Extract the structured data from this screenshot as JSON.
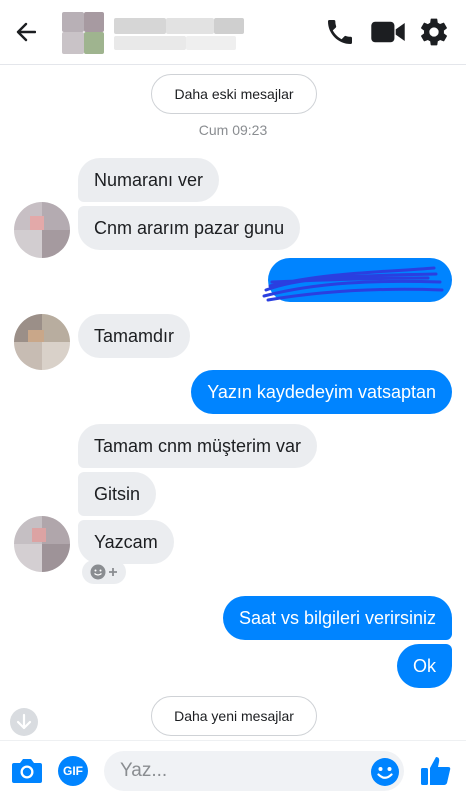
{
  "header": {
    "back_icon": "arrow-left-icon",
    "call_icon": "phone-icon",
    "video_icon": "video-camera-icon",
    "settings_icon": "gear-icon"
  },
  "chat": {
    "older_messages_label": "Daha eski mesajlar",
    "newer_messages_label": "Daha yeni mesajlar",
    "timestamp": "Cum 09:23",
    "messages": [
      {
        "from": "them",
        "text": "Numaranı ver"
      },
      {
        "from": "them",
        "text": "Cnm ararım pazar gunu"
      },
      {
        "from": "me",
        "text": ""
      },
      {
        "from": "them",
        "text": "Tamamdır"
      },
      {
        "from": "me",
        "text": "Yazın kaydedeyim vatsaptan"
      },
      {
        "from": "them",
        "text": "Tamam cnm müşterim var"
      },
      {
        "from": "them",
        "text": "Gitsin"
      },
      {
        "from": "them",
        "text": "Yazcam"
      },
      {
        "from": "me",
        "text": "Saat vs bilgileri verirsiniz"
      },
      {
        "from": "me",
        "text": "Ok"
      }
    ]
  },
  "composer": {
    "gif_label": "GIF",
    "placeholder": "Yaz...",
    "camera_icon": "camera-icon",
    "emoji_icon": "smiley-icon",
    "like_icon": "thumbs-up-icon"
  },
  "colors": {
    "accent": "#0084ff",
    "incoming_bubble": "#ebedf0",
    "redaction": "#2a3fe0"
  }
}
